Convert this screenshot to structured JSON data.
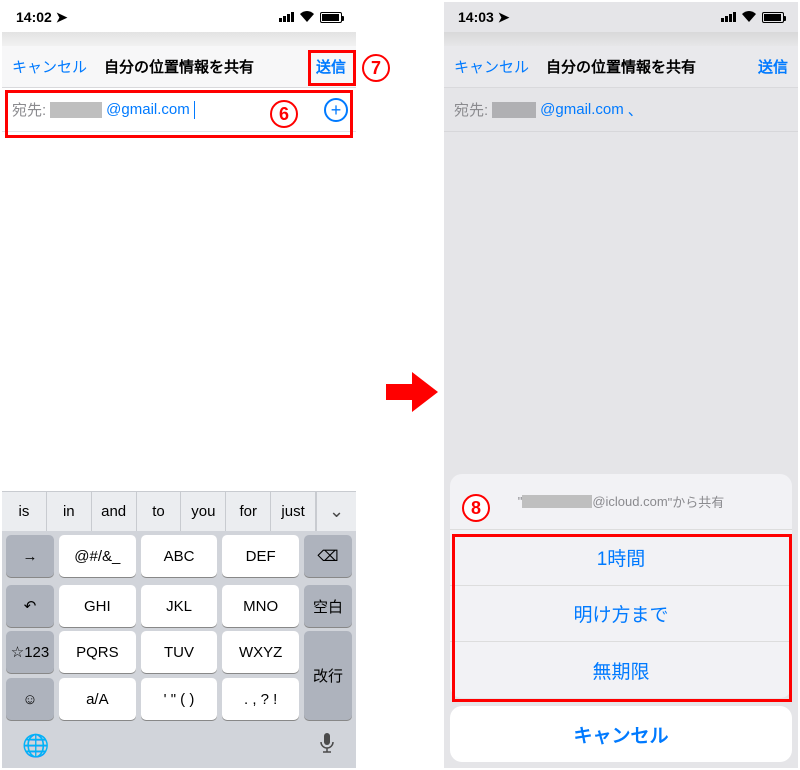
{
  "left": {
    "status": {
      "time": "14:02"
    },
    "nav": {
      "cancel": "キャンセル",
      "title": "自分の位置情報を共有",
      "send": "送信"
    },
    "recipient": {
      "label": "宛先:",
      "address_visible": "@gmail.com"
    },
    "keyboard": {
      "suggestions": [
        "is",
        "in",
        "and",
        "to",
        "you",
        "for",
        "just"
      ],
      "row1": [
        "@#/&_",
        "ABC",
        "DEF"
      ],
      "row2": [
        "GHI",
        "JKL",
        "MNO"
      ],
      "row3": [
        "PQRS",
        "TUV",
        "WXYZ"
      ],
      "row4": [
        "a/A",
        "' \" ( )",
        ". , ? !"
      ],
      "left_side": [
        "→",
        "↶",
        "☆123",
        "☺"
      ],
      "right_side": {
        "backspace": "⌫",
        "space": "空白",
        "return": "改行"
      }
    }
  },
  "right": {
    "status": {
      "time": "14:03"
    },
    "nav": {
      "cancel": "キャンセル",
      "title": "自分の位置情報を共有",
      "send": "送信"
    },
    "recipient": {
      "label": "宛先:",
      "address_visible": "@gmail.com",
      "trailing": "、"
    },
    "sheet": {
      "title_prefix": "\"",
      "title_visible": "@icloud.com",
      "title_suffix": "\"から共有",
      "options": [
        "1時間",
        "明け方まで",
        "無期限"
      ],
      "cancel": "キャンセル"
    }
  },
  "annotations": {
    "six": "6",
    "seven": "7",
    "eight": "8"
  }
}
